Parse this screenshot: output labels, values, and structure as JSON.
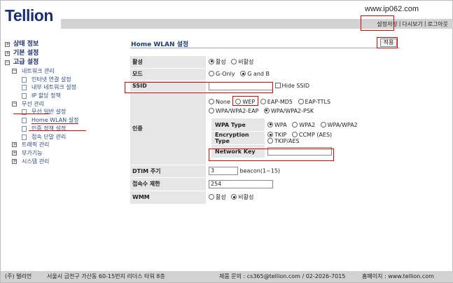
{
  "brand": {
    "logo": "Tellion",
    "watermark": "www.ip062.com"
  },
  "toplinks": {
    "save": "설정저장",
    "reboot": "다시보기",
    "logout": "로그아웃",
    "sep": "|"
  },
  "sidebar": {
    "status": "상태 정보",
    "basic": "기본 설정",
    "advanced": "고급 설정",
    "network_mgmt": "네트워크 관리",
    "internet": "인터넷 연결 설정",
    "lan": "내부 네트워크 설정",
    "ip": "IP 할당 정책",
    "wireless": "무선 관리",
    "wireless_basic": "무선 일반 설정",
    "home_wlan": "Home WLAN 설정",
    "wlan_security": "인증 정책 설정",
    "wlan_mgmt": "접속 단말 관리",
    "traffic": "트래픽 관리",
    "extra": "부가기능",
    "system": "시스템 관리"
  },
  "main": {
    "title": "Home WLAN 설정",
    "apply": "적용",
    "activate": {
      "label": "활성",
      "on": "활성",
      "off": "비활성"
    },
    "mode": {
      "label": "모드",
      "g_only": "G-Only",
      "g_and_b": "G and B"
    },
    "ssid": {
      "label": "SSID",
      "value": "",
      "hide": "Hide SSID"
    },
    "auth": {
      "label": "인증",
      "none": "None",
      "wep": "WEP",
      "eap_md5": "EAP-MD5",
      "eap_ttls": "EAP-TTLS",
      "wpa_eap": "WPA/WPA2-EAP",
      "wpa_psk": "WPA/WPA2-PSK",
      "wpa_type_label": "WPA Type",
      "wpa": "WPA",
      "wpa2": "WPA2",
      "wpa_wpa2": "WPA/WPA2",
      "enc_label": "Encryption Type",
      "tkip": "TKIP",
      "ccmp": "CCMP (AES)",
      "tkip_aes": "TKIP/AES",
      "key_label": "Network Key",
      "key_value": ""
    },
    "dtim": {
      "label": "DTIM 주기",
      "value": "3",
      "unit": "beacon(1~15)"
    },
    "limit": {
      "label": "접속수 제한",
      "value": "254"
    },
    "wmm": {
      "label": "WMM",
      "on": "활성",
      "off": "비활성"
    }
  },
  "footer": {
    "company": "(주) 텔리언",
    "address": "서울시 금천구 가산동 60-15번지 리더스 타워 8층",
    "contact": "제품 문의 : cs365@tellion.com / 02-2026-7015",
    "homepage": "홈페이지 : www.tellion.com"
  }
}
